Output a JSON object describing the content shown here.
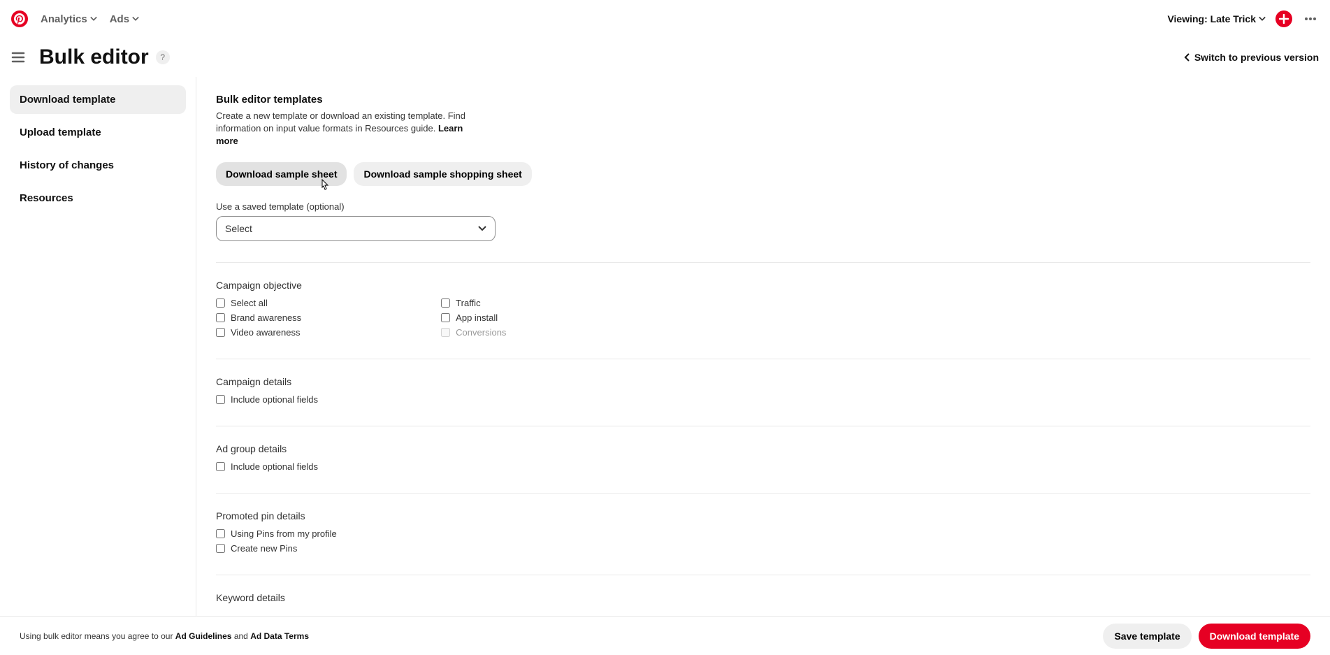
{
  "topnav": {
    "analytics": "Analytics",
    "ads": "Ads",
    "viewing": "Viewing: Late Trick"
  },
  "header": {
    "title": "Bulk editor",
    "switch": "Switch to previous version"
  },
  "sidebar": {
    "items": [
      {
        "label": "Download template",
        "active": true
      },
      {
        "label": "Upload template",
        "active": false
      },
      {
        "label": "History of changes",
        "active": false
      },
      {
        "label": "Resources",
        "active": false
      }
    ]
  },
  "templates": {
    "title": "Bulk editor templates",
    "desc": "Create a new template or download an existing template. Find information on input value formats in Resources guide. ",
    "learn_more": "Learn more",
    "download_sample": "Download sample sheet",
    "download_shopping": "Download sample shopping sheet",
    "saved_label": "Use a saved template (optional)",
    "select_placeholder": "Select"
  },
  "campaign_objective": {
    "title": "Campaign objective",
    "left": [
      "Select all",
      "Brand awareness",
      "Video awareness"
    ],
    "right": [
      "Traffic",
      "App install",
      "Conversions"
    ],
    "disabled": [
      "Conversions"
    ]
  },
  "campaign_details": {
    "title": "Campaign details",
    "opt": "Include optional fields"
  },
  "ad_group_details": {
    "title": "Ad group details",
    "opt": "Include optional fields"
  },
  "promoted_pin": {
    "title": "Promoted pin details",
    "items": [
      "Using Pins from my profile",
      "Create new Pins"
    ]
  },
  "keyword": {
    "title": "Keyword details"
  },
  "footer": {
    "pre": "Using bulk editor means you agree to our ",
    "ad_guidelines": "Ad Guidelines",
    "and": " and ",
    "ad_data": "Ad Data Terms",
    "save": "Save template",
    "download": "Download template"
  }
}
